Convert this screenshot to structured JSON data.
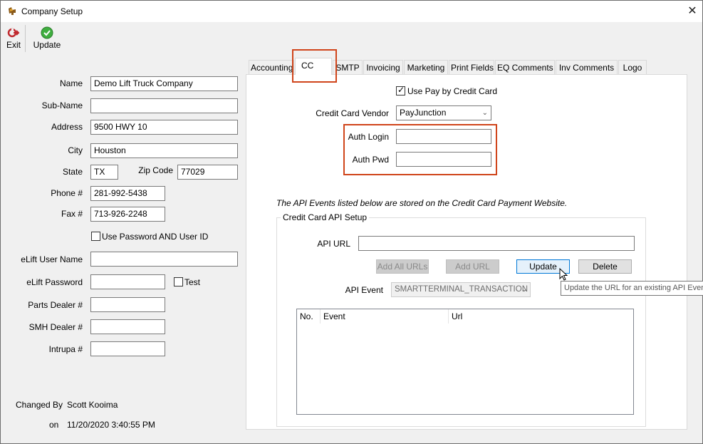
{
  "window": {
    "title": "Company Setup",
    "close_glyph": "✕",
    "icon": "truck-logo-icon"
  },
  "toolbar": {
    "exit_label": "Exit",
    "exit_icon": "exit-icon",
    "update_label": "Update",
    "update_icon": "green-check-icon"
  },
  "left_form": {
    "name": {
      "label": "Name",
      "value": "Demo Lift Truck Company"
    },
    "sub_name": {
      "label": "Sub-Name",
      "value": ""
    },
    "address": {
      "label": "Address",
      "value": "9500 HWY 10"
    },
    "city": {
      "label": "City",
      "value": "Houston"
    },
    "state": {
      "label": "State",
      "value": "TX"
    },
    "zip": {
      "label": "Zip Code",
      "value": "77029"
    },
    "phone": {
      "label": "Phone #",
      "value": "281-992-5438"
    },
    "fax": {
      "label": "Fax #",
      "value": "713-926-2248"
    },
    "use_password": {
      "label": "Use Password AND User ID",
      "checked": false
    },
    "elift_user": {
      "label": "eLift User Name",
      "value": ""
    },
    "elift_password": {
      "label": "eLift Password",
      "value": ""
    },
    "test": {
      "label": "Test",
      "checked": false
    },
    "parts_dealer": {
      "label": "Parts Dealer #",
      "value": ""
    },
    "smh_dealer": {
      "label": "SMH Dealer #",
      "value": ""
    },
    "intrupa": {
      "label": "Intrupa #",
      "value": ""
    },
    "changed_by_label": "Changed By",
    "changed_by_value": "Scott Kooima",
    "on_label": "on",
    "on_value": "11/20/2020 3:40:55 PM"
  },
  "tabs": [
    "Accounting",
    "CC",
    "SMTP",
    "Invoicing",
    "Marketing",
    "Print Fields",
    "EQ Comments",
    "Inv Comments",
    "Logo"
  ],
  "active_tab": "CC",
  "cc": {
    "use_pay_by_cc": {
      "label": "Use Pay by Credit Card",
      "checked": true
    },
    "vendor": {
      "label": "Credit Card Vendor",
      "value": "PayJunction"
    },
    "auth_login": {
      "label": "Auth Login",
      "value": ""
    },
    "auth_pwd": {
      "label": "Auth Pwd",
      "value": ""
    },
    "api_note": "The API Events listed below are stored on the Credit Card Payment Website.",
    "group_title": "Credit Card API Setup",
    "api_url": {
      "label": "API URL",
      "value": ""
    },
    "buttons": {
      "add_all": "Add All URLs",
      "add_url": "Add URL",
      "update": "Update",
      "delete": "Delete"
    },
    "api_event": {
      "label": "API Event",
      "value": "SMARTTERMINAL_TRANSACTION"
    },
    "list_columns": [
      "No.",
      "Event",
      "Url"
    ],
    "tooltip": "Update the URL for an existing API Even"
  },
  "colors": {
    "highlight": "#d0451b",
    "accent": "#0078d7"
  }
}
